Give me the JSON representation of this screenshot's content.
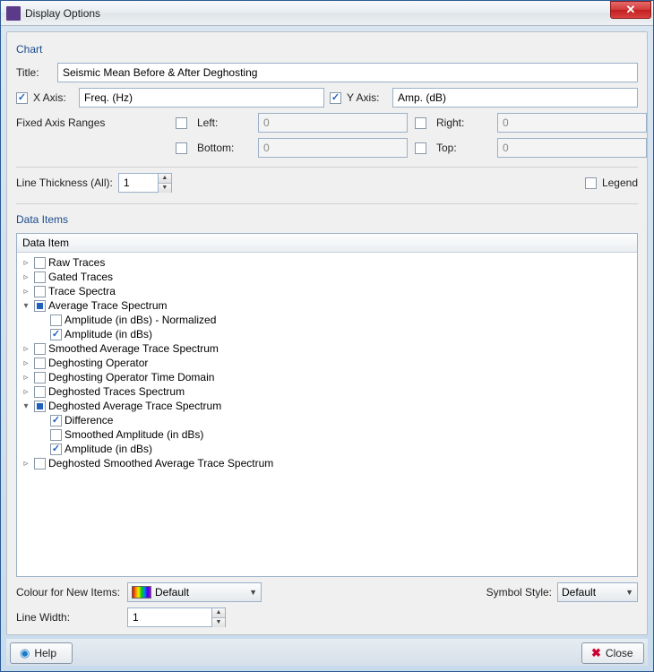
{
  "window": {
    "title": "Display Options"
  },
  "chart": {
    "group_label": "Chart",
    "title_label": "Title:",
    "title_value": "Seismic Mean Before & After Deghosting",
    "xaxis_label": "X Axis:",
    "xaxis_checked": true,
    "xaxis_value": "Freq. (Hz)",
    "yaxis_label": "Y Axis:",
    "yaxis_checked": true,
    "yaxis_value": "Amp. (dB)",
    "fixed_label": "Fixed Axis Ranges",
    "left_label": "Left:",
    "left_value": "0",
    "right_label": "Right:",
    "right_value": "0",
    "bottom_label": "Bottom:",
    "bottom_value": "0",
    "top_label": "Top:",
    "top_value": "0",
    "thickness_label": "Line Thickness (All):",
    "thickness_value": "1",
    "legend_label": "Legend"
  },
  "data_items": {
    "group_label": "Data Items",
    "header": "Data Item",
    "tree": [
      {
        "label": "Raw Traces",
        "state": "unchecked",
        "expand": "collapsed"
      },
      {
        "label": "Gated Traces",
        "state": "unchecked",
        "expand": "collapsed"
      },
      {
        "label": "Trace Spectra",
        "state": "unchecked",
        "expand": "collapsed"
      },
      {
        "label": "Average Trace Spectrum",
        "state": "indet",
        "expand": "expanded",
        "children": [
          {
            "label": "Amplitude (in dBs) - Normalized",
            "state": "unchecked"
          },
          {
            "label": "Amplitude (in dBs)",
            "state": "checked"
          }
        ]
      },
      {
        "label": "Smoothed Average Trace Spectrum",
        "state": "unchecked",
        "expand": "collapsed"
      },
      {
        "label": "Deghosting Operator",
        "state": "unchecked",
        "expand": "collapsed"
      },
      {
        "label": "Deghosting Operator Time Domain",
        "state": "unchecked",
        "expand": "collapsed"
      },
      {
        "label": "Deghosted Traces Spectrum",
        "state": "unchecked",
        "expand": "collapsed"
      },
      {
        "label": "Deghosted Average Trace Spectrum",
        "state": "indet",
        "expand": "expanded",
        "children": [
          {
            "label": "Difference",
            "state": "checked"
          },
          {
            "label": "Smoothed Amplitude (in dBs)",
            "state": "unchecked"
          },
          {
            "label": "Amplitude (in dBs)",
            "state": "checked"
          }
        ]
      },
      {
        "label": "Deghosted Smoothed Average Trace Spectrum",
        "state": "unchecked",
        "expand": "collapsed"
      }
    ]
  },
  "footer": {
    "colour_label": "Colour for New Items:",
    "colour_value": "Default",
    "symbol_label": "Symbol Style:",
    "symbol_value": "Default",
    "linewidth_label": "Line Width:",
    "linewidth_value": "1"
  },
  "buttons": {
    "help": "Help",
    "close": "Close"
  }
}
